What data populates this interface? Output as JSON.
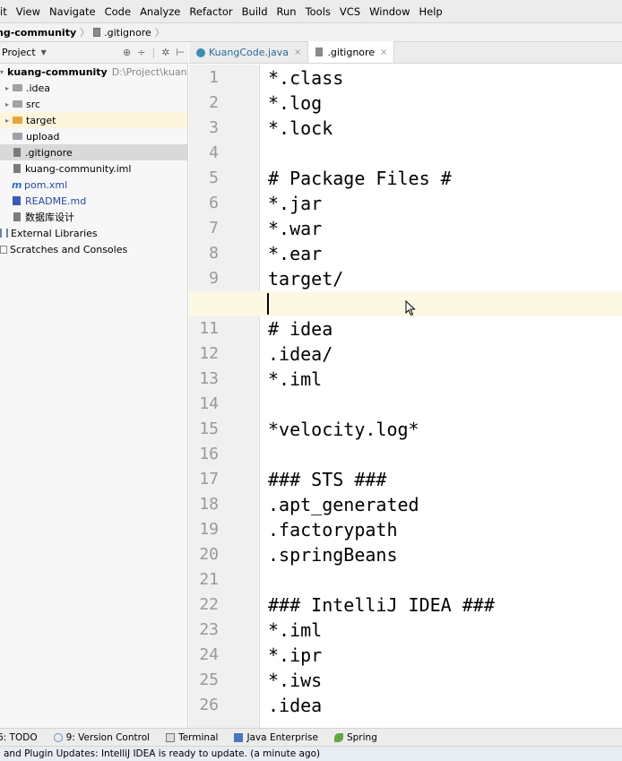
{
  "menu": [
    "it",
    "View",
    "Navigate",
    "Code",
    "Analyze",
    "Refactor",
    "Build",
    "Run",
    "Tools",
    "VCS",
    "Window",
    "Help"
  ],
  "breadcrumb": {
    "project": "ng-community",
    "file": ".gitignore"
  },
  "project_panel": {
    "title": "Project",
    "tree": [
      {
        "label": "kuang-community",
        "path": "D:\\Project\\kuang-c",
        "icon": "project-icon"
      },
      {
        "label": ".idea",
        "icon": "folder-icon"
      },
      {
        "label": "src",
        "icon": "folder-icon"
      },
      {
        "label": "target",
        "icon": "folder-orange-icon"
      },
      {
        "label": "upload",
        "icon": "folder-icon"
      },
      {
        "label": ".gitignore",
        "icon": "file-icon"
      },
      {
        "label": "kuang-community.iml",
        "icon": "module-file-icon"
      },
      {
        "label": "pom.xml",
        "icon": "maven-icon"
      },
      {
        "label": "README.md",
        "icon": "markdown-icon"
      },
      {
        "label": "数据库设计",
        "icon": "file-icon"
      },
      {
        "label": "External Libraries",
        "icon": "library-icon"
      },
      {
        "label": "Scratches and Consoles",
        "icon": "scratch-icon"
      }
    ]
  },
  "tabs": [
    {
      "label": "KuangCode.java",
      "icon": "java-class-icon",
      "active": false
    },
    {
      "label": ".gitignore",
      "icon": "file-icon",
      "active": true
    }
  ],
  "editor": {
    "current_line": 10,
    "lines": [
      "*.class",
      "*.log",
      "*.lock",
      "",
      "# Package Files #",
      "*.jar",
      "*.war",
      "*.ear",
      "target/",
      "",
      "# idea",
      ".idea/",
      "*.iml",
      "",
      "*velocity.log*",
      "",
      "### STS ###",
      ".apt_generated",
      ".factorypath",
      ".springBeans",
      "",
      "### IntelliJ IDEA ###",
      "*.iml",
      "*.ipr",
      "*.iws",
      ".idea"
    ],
    "line_numbers": [
      "1",
      "2",
      "3",
      "4",
      "5",
      "6",
      "7",
      "8",
      "9",
      "10",
      "11",
      "12",
      "13",
      "14",
      "15",
      "16",
      "17",
      "18",
      "19",
      "20",
      "21",
      "22",
      "23",
      "24",
      "25",
      "26"
    ]
  },
  "bottom_bar": [
    {
      "label": "6: TODO",
      "icon": "todo-icon"
    },
    {
      "label": "9: Version Control",
      "icon": "version-control-icon"
    },
    {
      "label": "Terminal",
      "icon": "terminal-icon"
    },
    {
      "label": "Java Enterprise",
      "icon": "java-enterprise-icon"
    },
    {
      "label": "Spring",
      "icon": "spring-icon"
    }
  ],
  "status": "and Plugin Updates: IntelliJ IDEA is ready to update. (a minute ago)"
}
